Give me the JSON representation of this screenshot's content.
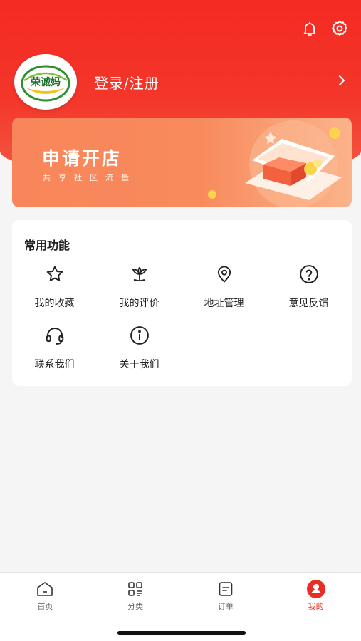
{
  "header": {
    "bell_icon": "bell-icon",
    "settings_icon": "gear-icon"
  },
  "profile": {
    "logo_text": "荣诚妈",
    "login_label": "登录/注册"
  },
  "banner": {
    "title": "申请开店",
    "subtitle": "共享社区流量"
  },
  "functions": {
    "title": "常用功能",
    "items": [
      {
        "label": "我的收藏",
        "icon": "star-icon"
      },
      {
        "label": "我的评价",
        "icon": "flower-icon"
      },
      {
        "label": "地址管理",
        "icon": "location-pin-icon"
      },
      {
        "label": "意见反馈",
        "icon": "question-icon"
      },
      {
        "label": "联系我们",
        "icon": "headset-icon"
      },
      {
        "label": "关于我们",
        "icon": "info-icon"
      }
    ]
  },
  "tabbar": {
    "tabs": [
      {
        "label": "首页",
        "icon": "home-icon"
      },
      {
        "label": "分类",
        "icon": "category-grid-icon"
      },
      {
        "label": "订单",
        "icon": "order-icon"
      },
      {
        "label": "我的",
        "icon": "profile-icon"
      }
    ],
    "active": "我的",
    "active_color": "#e82e24"
  }
}
